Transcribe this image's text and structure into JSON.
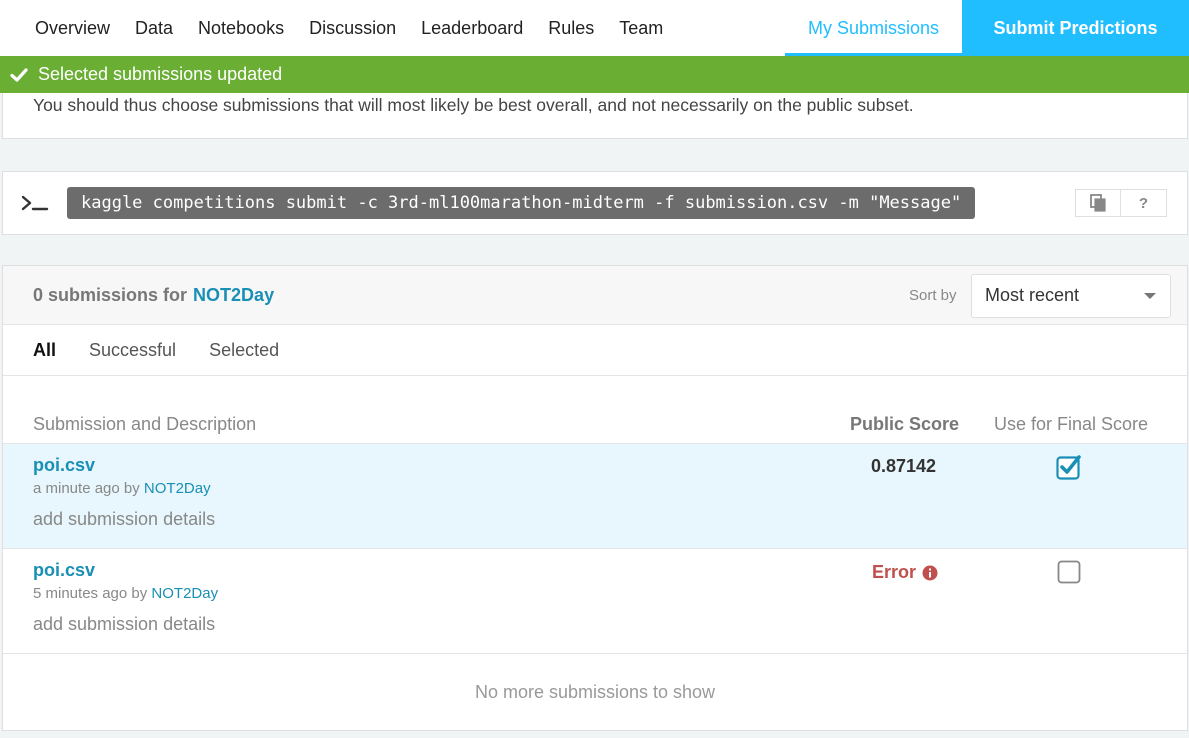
{
  "nav": {
    "tabs": [
      "Overview",
      "Data",
      "Notebooks",
      "Discussion",
      "Leaderboard",
      "Rules",
      "Team"
    ],
    "my_submissions": "My Submissions",
    "submit_predictions": "Submit Predictions"
  },
  "banner": {
    "message": "Selected submissions updated",
    "color": "#6aae34"
  },
  "info": {
    "text": "You should thus choose submissions that will most likely be best overall, and not necessarily on the public subset."
  },
  "api": {
    "command": "kaggle competitions submit -c 3rd-ml100marathon-midterm -f submission.csv -m \"Message\"",
    "help_label": "?"
  },
  "submissions": {
    "count_text": "0 submissions for",
    "user": "NOT2Day",
    "sort_label": "Sort by",
    "sort_value": "Most recent",
    "filters": [
      "All",
      "Successful",
      "Selected"
    ],
    "active_filter": "All",
    "columns": {
      "description": "Submission and Description",
      "public_score": "Public Score",
      "final_score": "Use for Final Score"
    },
    "rows": [
      {
        "file": "poi.csv",
        "time": "a minute ago by",
        "user": "NOT2Day",
        "details": "add submission details",
        "score": "0.87142",
        "selected": true
      },
      {
        "file": "poi.csv",
        "time": "5 minutes ago by",
        "user": "NOT2Day",
        "details": "add submission details",
        "score": "Error",
        "selected": false
      }
    ],
    "no_more": "No more submissions to show"
  },
  "colors": {
    "accent": "#20beff",
    "link": "#1a8fb5",
    "error": "#c0504d"
  }
}
